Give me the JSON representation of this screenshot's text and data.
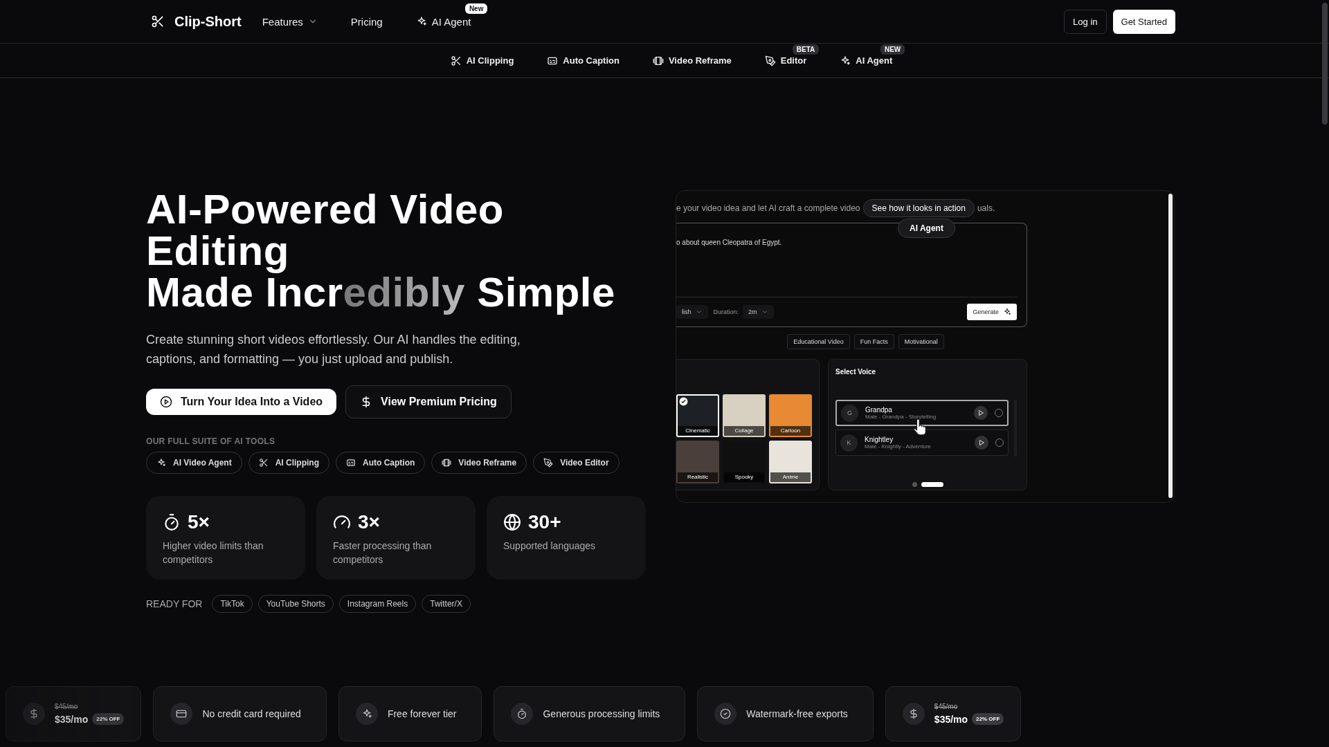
{
  "nav": {
    "brand": "Clip-Short",
    "links": [
      {
        "label": "Features",
        "kind": "dropdown"
      },
      {
        "label": "Pricing",
        "kind": "link"
      },
      {
        "label": "AI Agent",
        "kind": "agent",
        "badge": "New"
      }
    ],
    "login": "Log in",
    "cta": "Get Started"
  },
  "subnav": [
    {
      "label": "AI Clipping",
      "kind": "clipping"
    },
    {
      "label": "Auto Caption",
      "kind": "caption"
    },
    {
      "label": "Video Reframe",
      "kind": "reframe"
    },
    {
      "label": "Editor",
      "kind": "editor",
      "badge": "BETA"
    },
    {
      "label": "AI Agent",
      "kind": "agent",
      "badge": "NEW"
    }
  ],
  "hero": {
    "title_lines": [
      [
        {
          "text": "AI-Powered Video",
          "kind": "plain"
        }
      ],
      [
        {
          "text": "Editing",
          "kind": "plain"
        }
      ],
      [
        {
          "text": "Made Incr",
          "kind": "plain"
        },
        {
          "text": "edibly",
          "kind": "faded"
        },
        {
          "text": " Simple",
          "kind": "plain"
        }
      ]
    ],
    "subtitle": "Create stunning short videos effortlessly. Our AI handles the editing, captions, and formatting — you just upload and publish.",
    "buttons": [
      {
        "label": "Turn Your Idea Into a Video",
        "kind": "primary"
      },
      {
        "label": "View Premium Pricing",
        "kind": "secondary"
      }
    ],
    "tools_heading": "OUR FULL SUITE OF AI TOOLS",
    "tools": [
      {
        "label": "AI Video Agent",
        "kind": "agent"
      },
      {
        "label": "AI Clipping",
        "kind": "clipping"
      },
      {
        "label": "Auto Caption",
        "kind": "caption"
      },
      {
        "label": "Video Reframe",
        "kind": "reframe"
      },
      {
        "label": "Video Editor",
        "kind": "editor"
      }
    ],
    "stats": [
      {
        "value": "5×",
        "caption": "Higher video limits than competitors",
        "kind": "limits"
      },
      {
        "value": "3×",
        "caption": "Faster processing than competitors",
        "kind": "speed"
      },
      {
        "value": "30+",
        "caption": "Supported languages",
        "kind": "languages"
      }
    ],
    "ready_label": "READY FOR",
    "platforms": [
      "TikTok",
      "YouTube Shorts",
      "Instagram Reels",
      "Twitter/X"
    ]
  },
  "demo": {
    "intro_before": "e your video idea and let AI craft a complete video",
    "intro_after": "uals.",
    "tooltip": "See how it looks in action",
    "badge": "AI Agent",
    "prompt": "o about queen Cleopatra of Egypt.",
    "language": "lish",
    "duration_label": "Duration:",
    "duration": "2m",
    "generate": "Generate",
    "templates": [
      "Educational Video",
      "Fun Facts",
      "Motivational"
    ],
    "styles": [
      {
        "label": "Cinematic",
        "selected": true
      },
      {
        "label": "Collage",
        "selected": false
      },
      {
        "label": "Cartoon",
        "selected": false
      },
      {
        "label": "Realistic",
        "selected": false
      },
      {
        "label": "Spooky",
        "selected": false
      },
      {
        "label": "Anime",
        "selected": false
      }
    ],
    "voice_heading": "Select Voice",
    "voices": [
      {
        "initial": "G",
        "name": "Grandpa",
        "details": "Male - Grandpa - Storytelling",
        "selected": true
      },
      {
        "initial": "K",
        "name": "Knightley",
        "details": "Male - Knightly - Adventure",
        "selected": false
      }
    ],
    "slides": [
      {
        "selected": false
      },
      {
        "selected": true
      }
    ]
  },
  "perks": [
    {
      "kind": "price",
      "old": "$45/mo",
      "price": "$35/mo",
      "badge": "22% OFF"
    },
    {
      "kind": "no-card",
      "label": "No credit card required"
    },
    {
      "kind": "free",
      "label": "Free forever tier"
    },
    {
      "kind": "limits",
      "label": "Generous processing limits"
    },
    {
      "kind": "watermark",
      "label": "Watermark-free exports"
    },
    {
      "kind": "price",
      "old": "$45/mo",
      "price": "$35/mo",
      "badge": "22% OFF"
    }
  ]
}
